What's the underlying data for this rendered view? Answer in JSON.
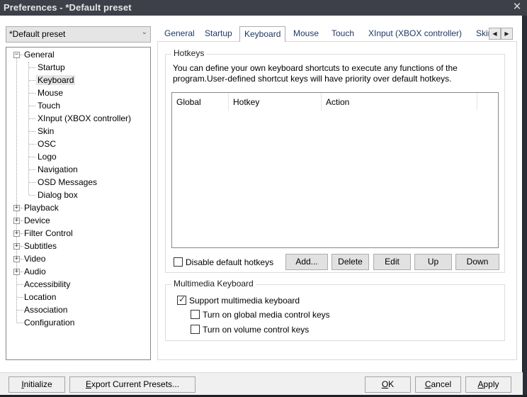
{
  "window": {
    "title": "Preferences - *Default preset",
    "close_glyph": "✕"
  },
  "preset": {
    "value": "*Default preset",
    "chevron": "⌄"
  },
  "tree": {
    "general": {
      "label": "General",
      "expanded": true,
      "children": [
        "Startup",
        "Keyboard",
        "Mouse",
        "Touch",
        "XInput (XBOX controller)",
        "Skin",
        "OSC",
        "Logo",
        "Navigation",
        "OSD Messages",
        "Dialog box"
      ],
      "selected": "Keyboard"
    },
    "collapsed": [
      "Playback",
      "Device",
      "Filter Control",
      "Subtitles",
      "Video",
      "Audio"
    ],
    "leaves": [
      "Accessibility",
      "Location",
      "Association",
      "Configuration"
    ],
    "minus": "−",
    "plus": "+"
  },
  "tabs": {
    "items": [
      "General",
      "Startup",
      "Keyboard",
      "Mouse",
      "Touch",
      "XInput (XBOX controller)",
      "Skin"
    ],
    "active": "Keyboard",
    "scroll_left": "◀",
    "scroll_right": "▶"
  },
  "hotkeys": {
    "title": "Hotkeys",
    "description_line1": "You can define your own keyboard shortcuts to execute any functions of the",
    "description_line2": "program.User-defined shortcut keys will have priority over default hotkeys.",
    "columns": [
      "Global",
      "Hotkey",
      "Action"
    ],
    "rows": [],
    "disable_default": {
      "label": "Disable default hotkeys",
      "checked": false
    },
    "buttons": {
      "add": "Add...",
      "delete": "Delete",
      "edit": "Edit",
      "up": "Up",
      "down": "Down"
    }
  },
  "multimedia": {
    "title": "Multimedia Keyboard",
    "support": {
      "label": "Support multimedia keyboard",
      "checked": true
    },
    "global_media": {
      "label": "Turn on global media control keys",
      "checked": false
    },
    "volume": {
      "label": "Turn on volume control keys",
      "checked": false
    },
    "tick": "✓"
  },
  "footer": {
    "initialize": {
      "mnemonic": "I",
      "rest": "nitialize"
    },
    "export": {
      "mnemonic": "E",
      "rest": "xport Current Presets..."
    },
    "ok": {
      "mnemonic": "O",
      "rest": "K"
    },
    "cancel": {
      "mnemonic": "C",
      "rest": "ancel"
    },
    "apply": {
      "mnemonic": "A",
      "rest": "pply"
    }
  }
}
